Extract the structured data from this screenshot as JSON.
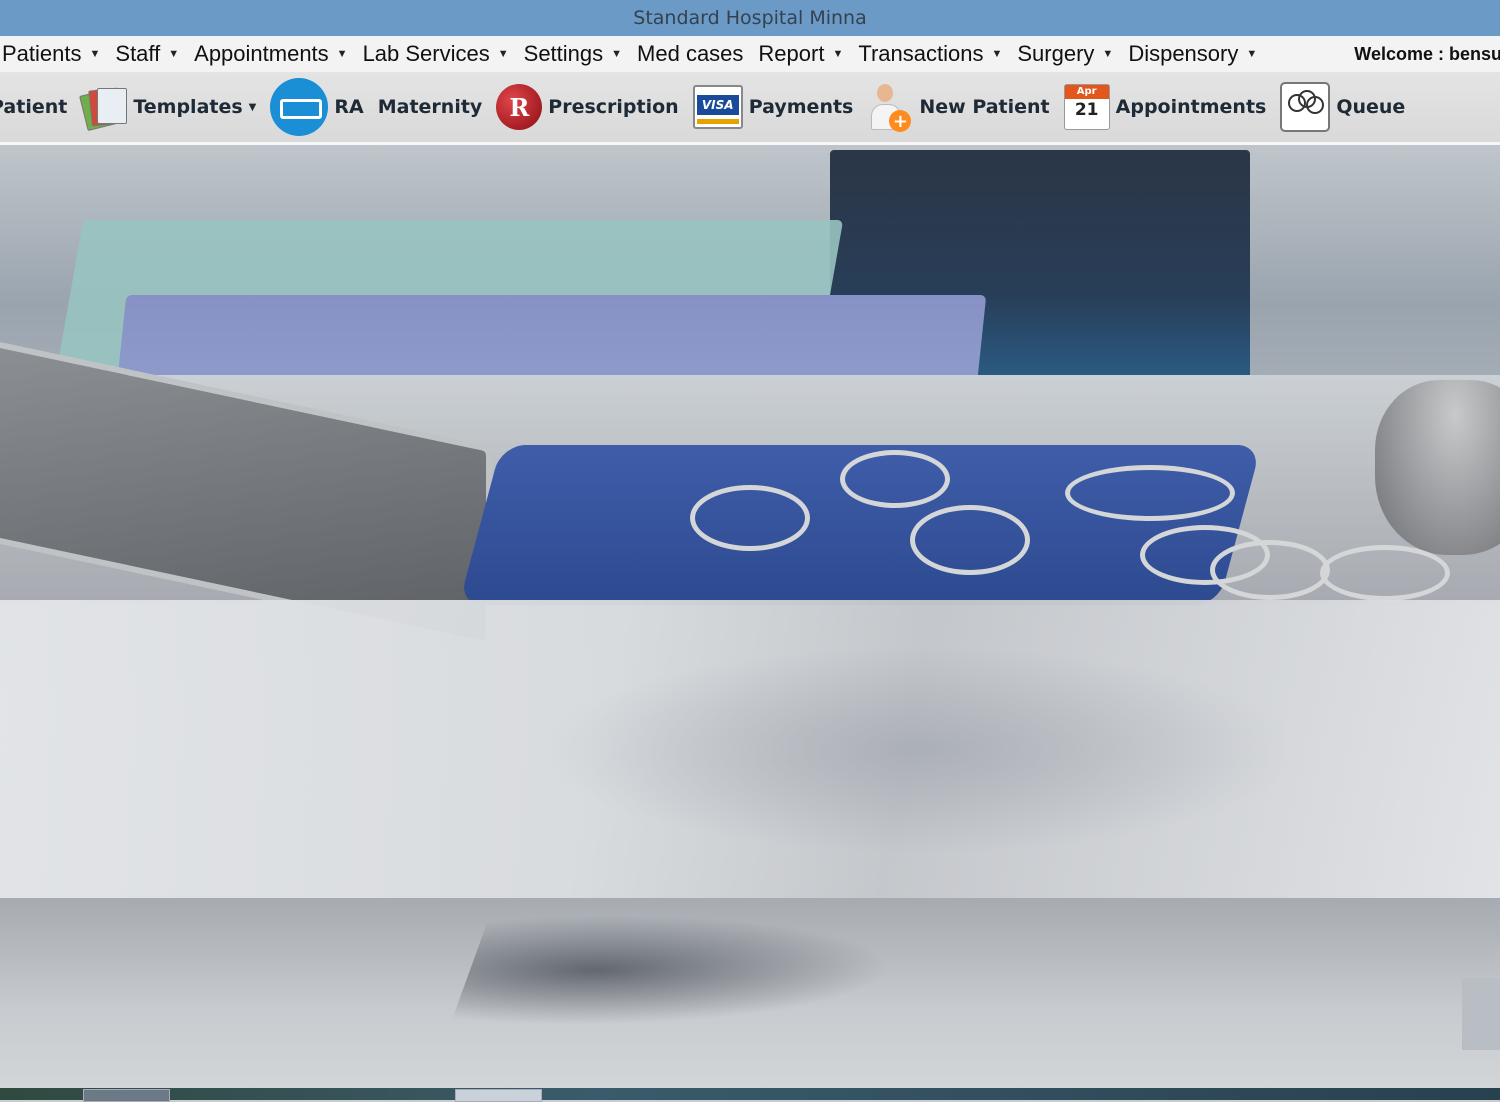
{
  "window": {
    "title": "Standard Hospital Minna"
  },
  "menubar": {
    "items": [
      {
        "label": "Patients",
        "has_dropdown": true
      },
      {
        "label": "Staff",
        "has_dropdown": true
      },
      {
        "label": "Appointments",
        "has_dropdown": true
      },
      {
        "label": "Lab Services",
        "has_dropdown": true
      },
      {
        "label": "Settings",
        "has_dropdown": true
      },
      {
        "label": "Med cases",
        "has_dropdown": false
      },
      {
        "label": "Report",
        "has_dropdown": true
      },
      {
        "label": "Transactions",
        "has_dropdown": true
      },
      {
        "label": "Surgery",
        "has_dropdown": true
      },
      {
        "label": "Dispensory",
        "has_dropdown": true
      }
    ],
    "welcome": "Welcome : bensu"
  },
  "toolbar": {
    "items": [
      {
        "label": "Patient",
        "icon": "patient-icon"
      },
      {
        "label": "Templates",
        "icon": "templates-icon",
        "has_dropdown": true
      },
      {
        "label": "RA",
        "icon": "bed-icon"
      },
      {
        "label": "Maternity",
        "icon": ""
      },
      {
        "label": "Prescription",
        "icon": "rx-icon"
      },
      {
        "label": "Payments",
        "icon": "visa-card-icon"
      },
      {
        "label": "New Patient",
        "icon": "add-user-icon"
      },
      {
        "label": "Appointments",
        "icon": "calendar-icon"
      },
      {
        "label": "Queue",
        "icon": "users-group-icon"
      }
    ],
    "calendar_month": "Apr",
    "calendar_day": "21",
    "rx_glyph": "R",
    "visa_text": "VISA",
    "plus_glyph": "+"
  },
  "colors": {
    "titlebar": "#6b9ac6",
    "menubar": "#f3f3f3",
    "toolbar": "#dcdcdc",
    "ra_icon": "#1a8fd6",
    "rx_icon": "#b0161d",
    "calendar_header": "#e2571c",
    "new_patient_plus": "#ff8a1e"
  }
}
